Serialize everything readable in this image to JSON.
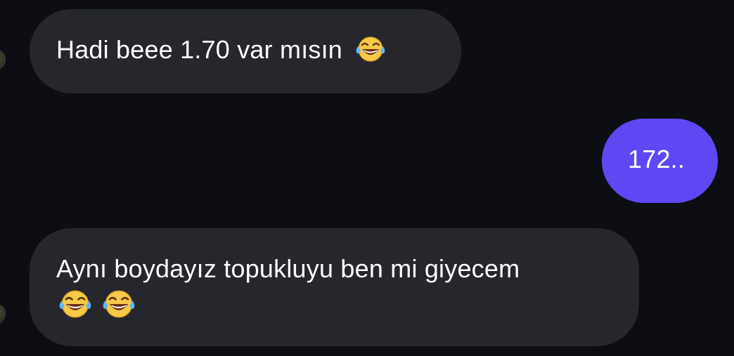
{
  "messages": [
    {
      "direction": "incoming",
      "text": "Hadi beee 1.70 var mısın",
      "emojis": [
        "face-with-tears-of-joy-icon"
      ]
    },
    {
      "direction": "outgoing",
      "text": "172..",
      "emojis": []
    },
    {
      "direction": "incoming",
      "text": "Aynı boydayız topukluyu ben mi giyecem",
      "emojis": [
        "face-with-tears-of-joy-icon",
        "face-with-tears-of-joy-icon"
      ]
    }
  ],
  "colors": {
    "background": "#0c0e13",
    "incoming_bubble": "#25272d",
    "outgoing_bubble": "#5e48f4",
    "text": "#ffffff"
  }
}
